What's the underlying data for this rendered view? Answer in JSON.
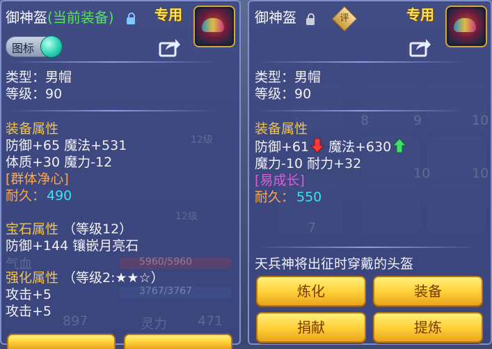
{
  "left": {
    "name": "御神盔",
    "equipped_tag": "(当前装备)",
    "exclusive": "专用",
    "icon_toggle_label": "图标",
    "type": "类型：男帽",
    "level": "等级：90",
    "equip_attr_title": "装备属性",
    "attr_line1": "防御+65 魔法+531",
    "attr_line2": "体质+30 魔力-12",
    "special_effect": "[群体净心]",
    "durability_label": "耐久：",
    "durability_value": "490",
    "gem_title": "宝石属性",
    "gem_level": "（等级12）",
    "gem_line": "防御+144 镶嵌月亮石",
    "enhance_title": "强化属性",
    "enhance_level": "（等级2:★★☆）",
    "enhance_line1": "攻击+5",
    "enhance_line2": "攻击+5"
  },
  "right": {
    "name": "御神盔",
    "rate_badge": "评",
    "exclusive": "专用",
    "type": "类型：男帽",
    "level": "等级：90",
    "equip_attr_title": "装备属性",
    "attr_defense": "防御+61",
    "attr_magic": "魔法+630",
    "attr_line2": "魔力-10 耐力+32",
    "special_effect": "[易成长]",
    "durability_label": "耐久：",
    "durability_value": "550",
    "description": "天兵神将出征时穿戴的头盔",
    "buttons": {
      "refine": "炼化",
      "equip": "装备",
      "donate": "捐献",
      "extract": "提炼"
    }
  },
  "background": {
    "hp_text": "5960/5960",
    "mp_text": "3767/3767",
    "attack_value": "897",
    "spirit_label": "灵力",
    "spirit_value": "471",
    "qixue_label": "气血",
    "item_level_label": "12级",
    "counts": [
      "8",
      "9",
      "10",
      "10",
      "10",
      "7"
    ]
  },
  "colors": {
    "green_text": "#52e25c",
    "gold_heading": "#f2c34a",
    "special_orange": "#ffa64a",
    "special_pink": "#e35ad9",
    "durability_cyan": "#3fe0f2",
    "button_gold": "#ffd23a"
  },
  "icons": {
    "lock_closed": "lock-icon",
    "lock_open": "unlock-icon",
    "share": "share-icon",
    "helmet": "helmet-item-icon",
    "down_arrow": "arrow-down-icon",
    "up_arrow": "arrow-up-icon"
  }
}
